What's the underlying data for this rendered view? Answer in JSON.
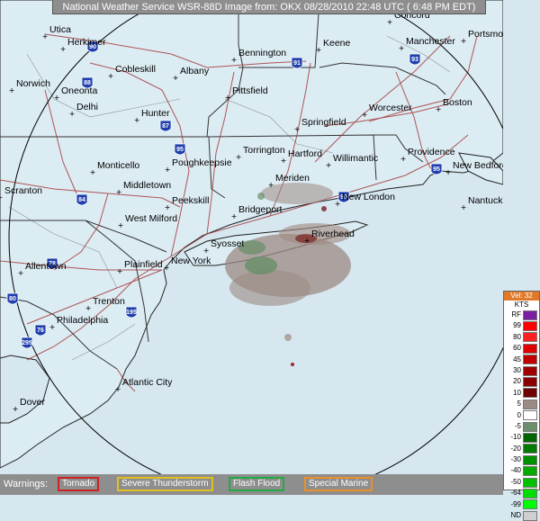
{
  "header": {
    "title": "National Weather Service WSR-88D Image from: OKX 08/28/2010 22:48 UTC ( 6:48 PM EDT)"
  },
  "map": {
    "cities": [
      {
        "name": "Utica"
      },
      {
        "name": "Herkimer"
      },
      {
        "name": "Norwich"
      },
      {
        "name": "Cobleskill"
      },
      {
        "name": "Albany"
      },
      {
        "name": "Oneonta"
      },
      {
        "name": "Delhi"
      },
      {
        "name": "Hunter"
      },
      {
        "name": "Bennington"
      },
      {
        "name": "Keene"
      },
      {
        "name": "Concord"
      },
      {
        "name": "Manchester"
      },
      {
        "name": "Portsmouth"
      },
      {
        "name": "Pittsfield"
      },
      {
        "name": "Worcester"
      },
      {
        "name": "Boston"
      },
      {
        "name": "Springfield"
      },
      {
        "name": "Monticello"
      },
      {
        "name": "Poughkeepsie"
      },
      {
        "name": "Torrington"
      },
      {
        "name": "Hartford"
      },
      {
        "name": "Willimantic"
      },
      {
        "name": "Providence"
      },
      {
        "name": "New Bedford"
      },
      {
        "name": "Middletown"
      },
      {
        "name": "Meriden"
      },
      {
        "name": "New London"
      },
      {
        "name": "Nantucket"
      },
      {
        "name": "Scranton"
      },
      {
        "name": "Peekskill"
      },
      {
        "name": "Bridgeport"
      },
      {
        "name": "West Milford"
      },
      {
        "name": "Riverhead"
      },
      {
        "name": "Syosset"
      },
      {
        "name": "Allentown"
      },
      {
        "name": "Plainfield"
      },
      {
        "name": "New York"
      },
      {
        "name": "Trenton"
      },
      {
        "name": "Philadelphia"
      },
      {
        "name": "Atlantic City"
      },
      {
        "name": "Dover"
      }
    ],
    "shields": [
      {
        "num": "90"
      },
      {
        "num": "88"
      },
      {
        "num": "87"
      },
      {
        "num": "91"
      },
      {
        "num": "93"
      },
      {
        "num": "84"
      },
      {
        "num": "95"
      },
      {
        "num": "78"
      },
      {
        "name": "80"
      },
      {
        "num": "76"
      },
      {
        "num": "195"
      },
      {
        "num": "295"
      },
      {
        "num": "95"
      },
      {
        "num": "95"
      }
    ]
  },
  "legend": {
    "title": "Vel: 32",
    "unit": "KTS",
    "items": [
      {
        "label": "RF",
        "color": "#7b1fa2"
      },
      {
        "label": "99",
        "color": "#ff0000"
      },
      {
        "label": "80",
        "color": "#ff2020"
      },
      {
        "label": "60",
        "color": "#e00000"
      },
      {
        "label": "45",
        "color": "#c00000"
      },
      {
        "label": "30",
        "color": "#a00000"
      },
      {
        "label": "20",
        "color": "#8a0000"
      },
      {
        "label": "10",
        "color": "#6e0000"
      },
      {
        "label": "5",
        "color": "#9c8b84"
      },
      {
        "label": "0",
        "color": "#ffffff"
      },
      {
        "label": "-5",
        "color": "#6b8f6b"
      },
      {
        "label": "-10",
        "color": "#006400"
      },
      {
        "label": "-20",
        "color": "#007a00"
      },
      {
        "label": "-30",
        "color": "#009000"
      },
      {
        "label": "-40",
        "color": "#00aa00"
      },
      {
        "label": "-50",
        "color": "#00c000"
      },
      {
        "label": "-64",
        "color": "#00dd00"
      },
      {
        "label": "-99",
        "color": "#00ff00"
      },
      {
        "label": "ND",
        "color": "#cfcfcf"
      }
    ]
  },
  "warnings": {
    "label": "Warnings:",
    "items": [
      {
        "label": "Tornado",
        "color": "#cc2222"
      },
      {
        "label": "Severe Thunderstorm",
        "color": "#e0c020"
      },
      {
        "label": "Flash Flood",
        "color": "#22aa44"
      },
      {
        "label": "Special Marine",
        "color": "#e8902a"
      }
    ]
  }
}
